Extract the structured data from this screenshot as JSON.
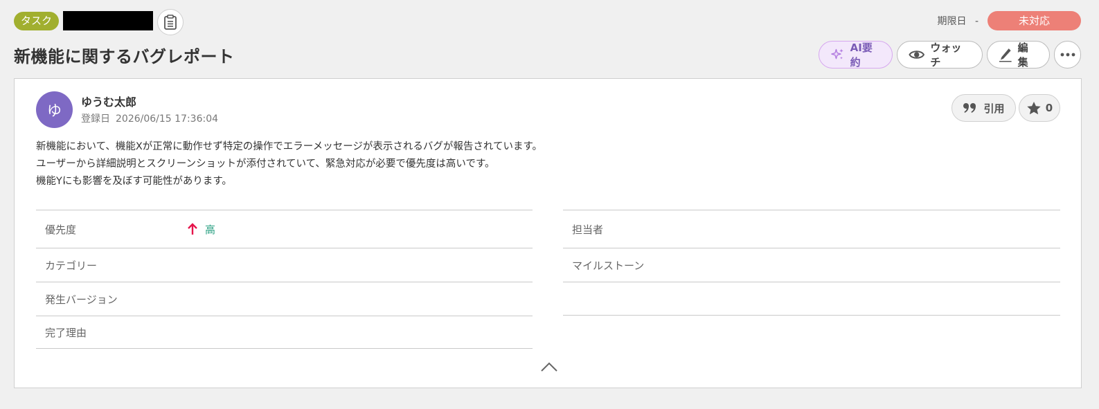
{
  "header": {
    "type_badge": "タスク",
    "due_label": "期限日",
    "due_value": "-",
    "status": "未対応",
    "status_color": "#ed8077",
    "type_color": "#a1af2f"
  },
  "title": "新機能に関するバグレポート",
  "actions": {
    "ai_summary": "AI要約",
    "watch": "ウォッチ",
    "edit": "編集"
  },
  "author": {
    "avatar_initial": "ゆ",
    "name": "ゆうむ太郎",
    "registered_label": "登録日",
    "registered_value": "2026/06/15 17:36:04",
    "avatar_color": "#7e69c4"
  },
  "post_actions": {
    "quote": "引用",
    "star_count": "0"
  },
  "description": [
    "新機能において、機能Xが正常に動作せず特定の操作でエラーメッセージが表示されるバグが報告されています。",
    "ユーザーから詳細説明とスクリーンショットが添付されていて、緊急対応が必要で優先度は高いです。",
    "機能Yにも影響を及ぼす可能性があります。"
  ],
  "properties_left": [
    {
      "label": "優先度",
      "value": "高"
    },
    {
      "label": "カテゴリー",
      "value": ""
    },
    {
      "label": "発生バージョン",
      "value": ""
    },
    {
      "label": "完了理由",
      "value": ""
    }
  ],
  "properties_right": [
    {
      "label": "担当者",
      "value": ""
    },
    {
      "label": "マイルストーン",
      "value": ""
    }
  ],
  "icons": {
    "copy": "clipboard-icon",
    "ai": "sparkle-icon",
    "watch": "eye-icon",
    "edit": "pencil-icon",
    "more": "more-dots-icon",
    "quote": "quote-icon",
    "star": "star-icon",
    "priority": "arrow-up-icon",
    "collapse": "chevron-up-icon"
  },
  "colors": {
    "priority_high_arrow": "#e5144b",
    "priority_high_text": "#2aa082",
    "ai_accent": "#7a5bb6"
  }
}
